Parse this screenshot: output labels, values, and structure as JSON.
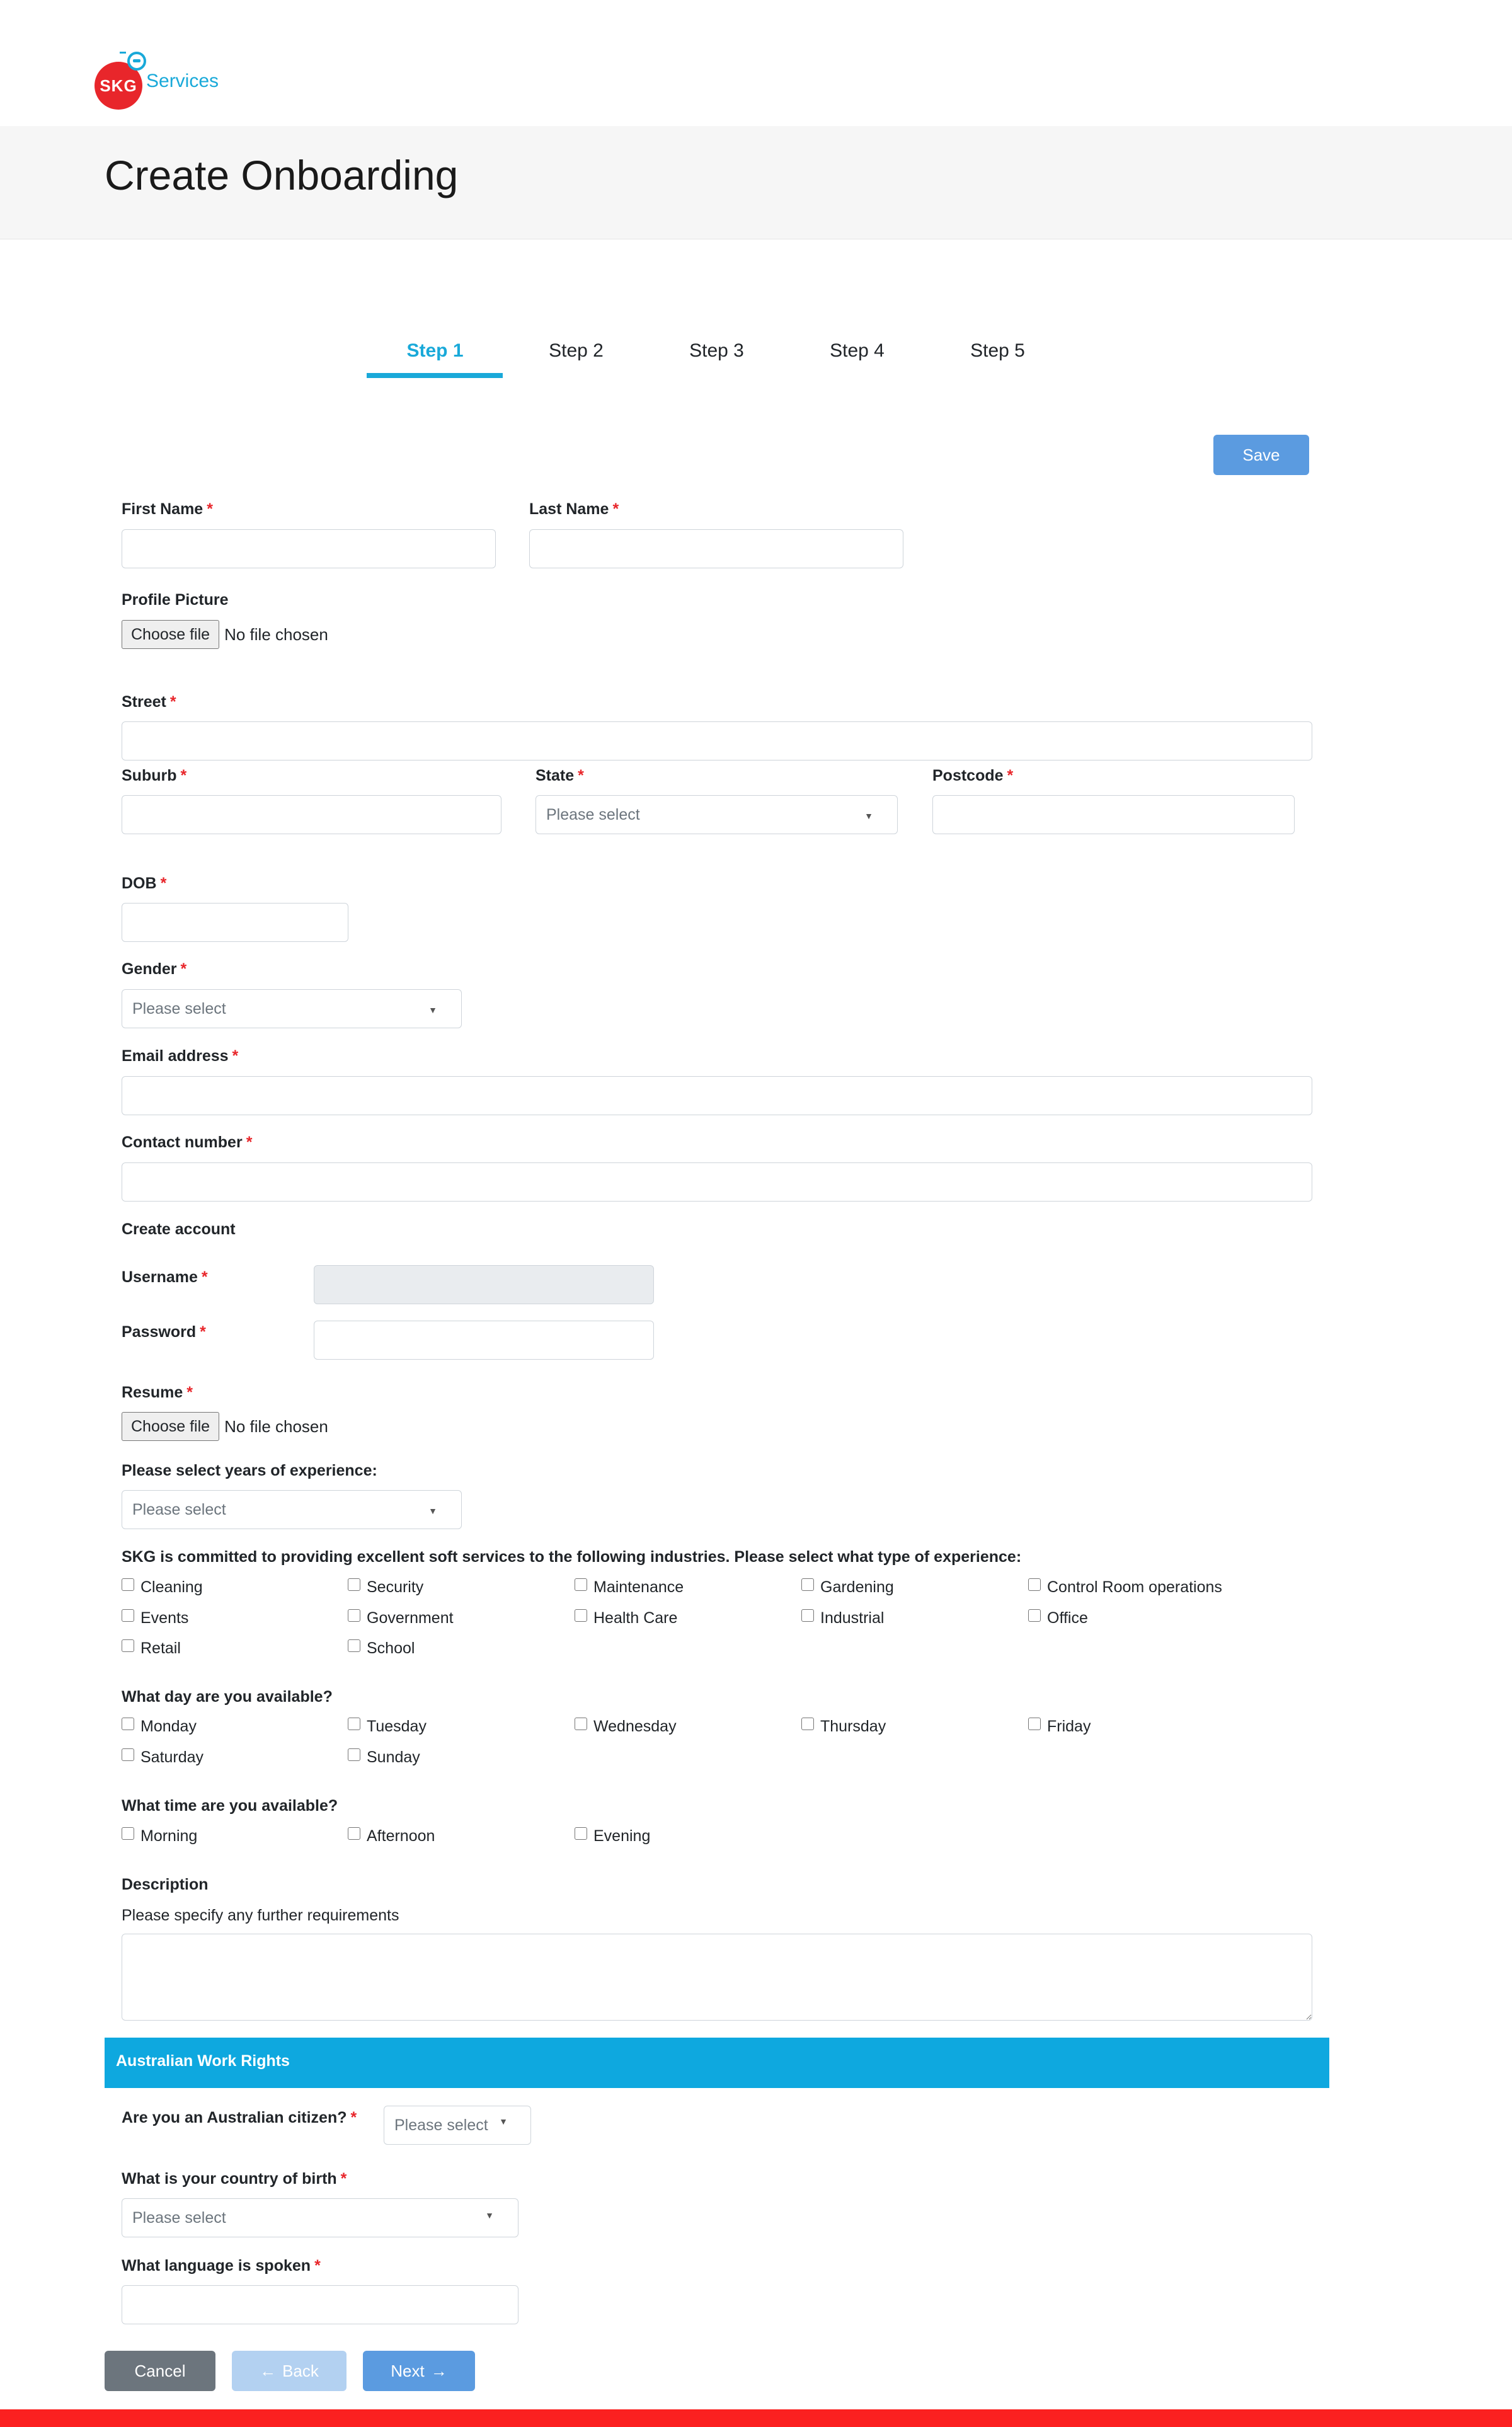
{
  "brand": {
    "logo_text": "SKG",
    "name": "Services"
  },
  "page": {
    "title": "Create Onboarding"
  },
  "steps": [
    {
      "label": "Step 1",
      "active": true
    },
    {
      "label": "Step 2",
      "active": false
    },
    {
      "label": "Step 3",
      "active": false
    },
    {
      "label": "Step 4",
      "active": false
    },
    {
      "label": "Step 5",
      "active": false
    }
  ],
  "actions": {
    "save": "Save",
    "cancel": "Cancel",
    "back": "Back",
    "next": "Next"
  },
  "required_marker": "*",
  "fields": {
    "first_name": "First Name",
    "last_name": "Last Name",
    "profile_picture": "Profile Picture",
    "street": "Street",
    "suburb": "Suburb",
    "state": "State",
    "postcode": "Postcode",
    "dob": "DOB",
    "gender": "Gender",
    "email": "Email address",
    "contact": "Contact number",
    "create_account": "Create account",
    "username": "Username",
    "password": "Password",
    "resume": "Resume",
    "experience_years": "Please select years of experience:",
    "industries_question": "SKG is committed to providing excellent soft services to the following industries. Please select what type of experience:",
    "days_question": "What day are you available?",
    "times_question": "What time are you available?",
    "description": "Description",
    "description_help": "Please specify any further requirements",
    "citizen": "Are you an Australian citizen?",
    "country_birth": "What is your country of birth",
    "language": "What language is spoken"
  },
  "file_input": {
    "button": "Choose file",
    "status": "No file chosen"
  },
  "select_placeholder": "Please select",
  "industries": [
    "Cleaning",
    "Security",
    "Maintenance",
    "Gardening",
    "Control Room operations",
    "Events",
    "Government",
    "Health Care",
    "Industrial",
    "Office",
    "Retail",
    "School"
  ],
  "days": [
    "Monday",
    "Tuesday",
    "Wednesday",
    "Thursday",
    "Friday",
    "Saturday",
    "Sunday"
  ],
  "times": [
    "Morning",
    "Afternoon",
    "Evening"
  ],
  "work_rights": {
    "title": "Australian Work Rights"
  },
  "colors": {
    "accent": "#19a9d9",
    "primary_button": "#5b9be0",
    "required": "#e8262b",
    "footer_bar": "#fb2020"
  }
}
